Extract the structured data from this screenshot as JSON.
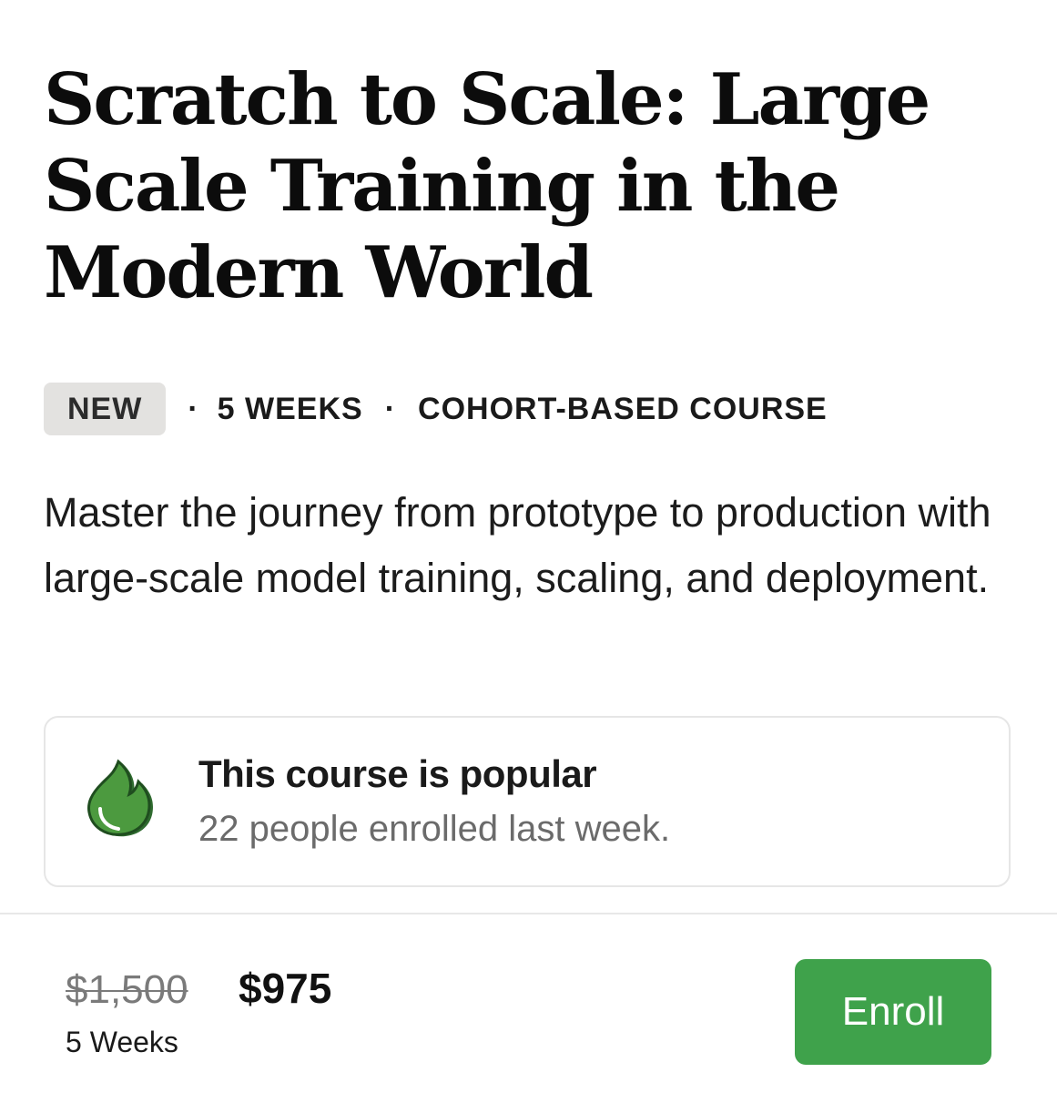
{
  "course": {
    "title": "Scratch to Scale: Large Scale Training in the Modern World",
    "badge": "NEW",
    "separator": "·",
    "duration_label": "5 WEEKS",
    "format_label": "COHORT-BASED COURSE",
    "description": "Master the journey from prototype to production with large-scale model training, scaling, and deployment."
  },
  "popular": {
    "icon": "flame-icon",
    "title": "This course is popular",
    "subtitle": "22 people enrolled last week."
  },
  "pricing": {
    "original_price": "$1,500",
    "sale_price": "$975",
    "duration": "5 Weeks",
    "enroll_label": "Enroll"
  },
  "colors": {
    "accent_green": "#3fa24b",
    "badge_bg": "#e3e2e0",
    "muted_text": "#6b6b6b"
  }
}
